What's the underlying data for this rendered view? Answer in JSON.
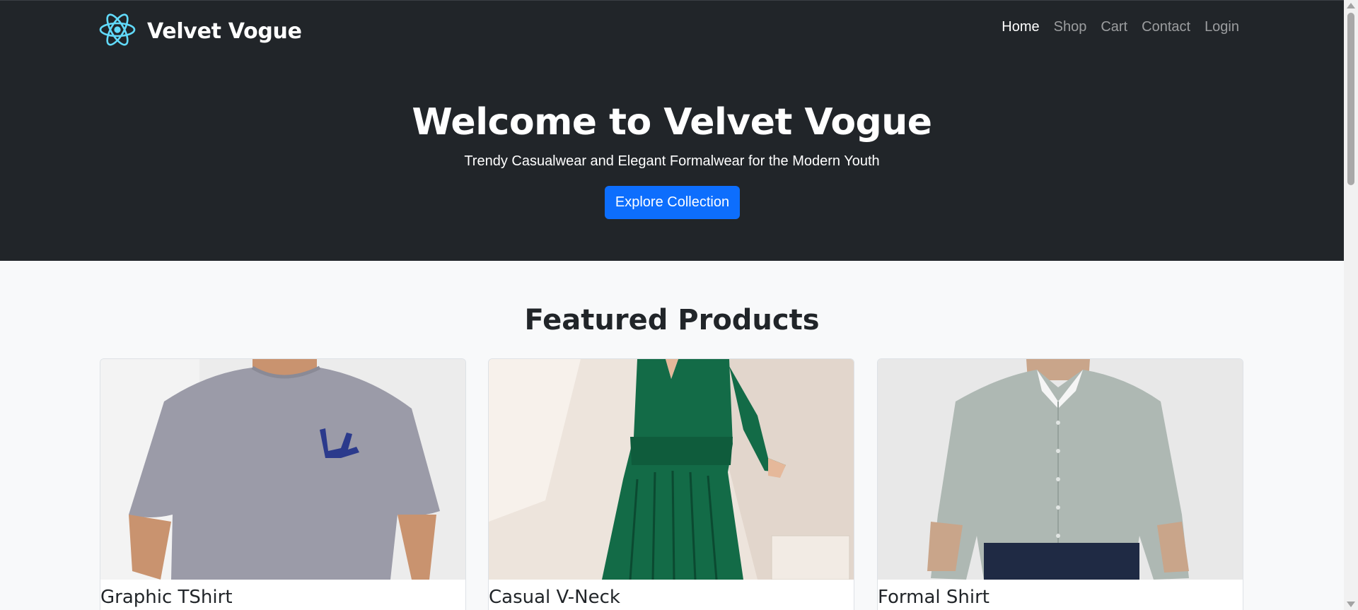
{
  "brand": {
    "name": "Velvet Vogue",
    "logo_icon": "react-atom-icon",
    "logo_color": "#61dafb"
  },
  "nav": {
    "items": [
      {
        "label": "Home",
        "active": true
      },
      {
        "label": "Shop",
        "active": false
      },
      {
        "label": "Cart",
        "active": false
      },
      {
        "label": "Contact",
        "active": false
      },
      {
        "label": "Login",
        "active": false
      }
    ]
  },
  "hero": {
    "title": "Welcome to Velvet Vogue",
    "subtitle": "Trendy Casualwear and Elegant Formalwear for the Modern Youth",
    "cta_label": "Explore Collection"
  },
  "featured": {
    "title": "Featured Products",
    "products": [
      {
        "name": "Graphic TShirt",
        "image": "grey-graphic-tshirt-photo"
      },
      {
        "name": "Casual V-Neck",
        "image": "green-v-neck-dress-photo"
      },
      {
        "name": "Formal Shirt",
        "image": "light-grey-formal-shirt-photo"
      }
    ]
  },
  "colors": {
    "hero_bg": "#212529",
    "primary": "#0d6efd",
    "page_bg": "#f8f9fa"
  }
}
